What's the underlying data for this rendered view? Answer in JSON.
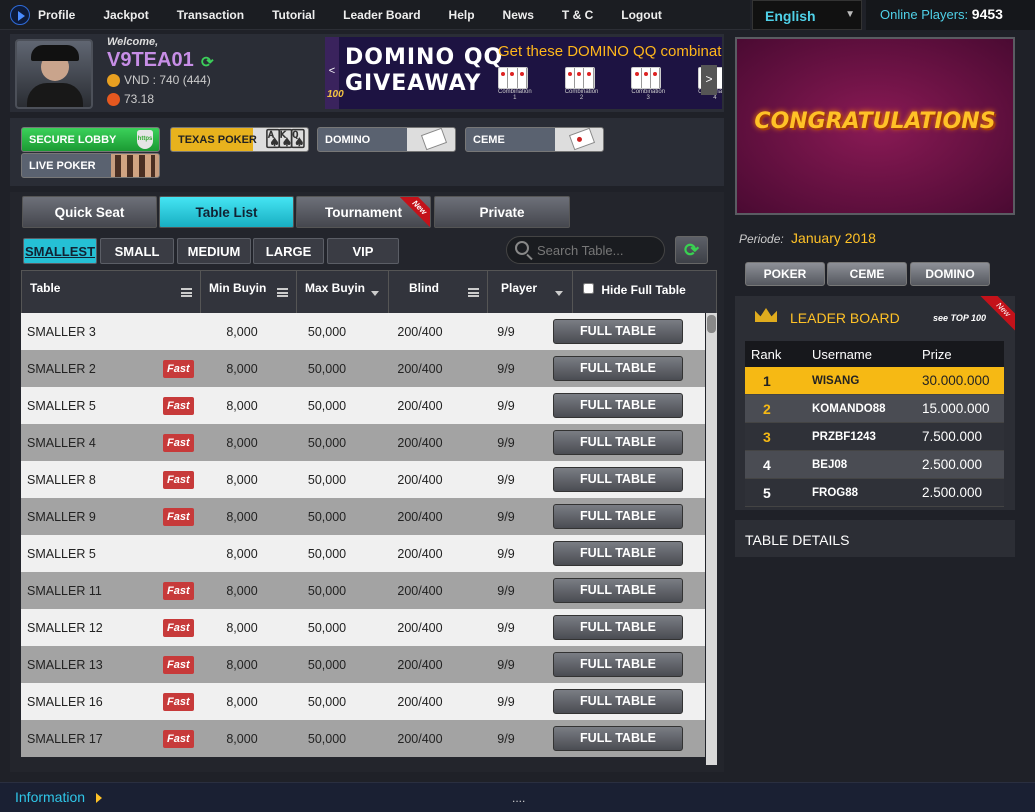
{
  "nav": {
    "items": [
      "Profile",
      "Jackpot",
      "Transaction",
      "Tutorial",
      "Leader Board",
      "Help",
      "News",
      "T & C",
      "Logout"
    ]
  },
  "language": {
    "selected": "English"
  },
  "online": {
    "label": "Online Players:",
    "count": "9453"
  },
  "user": {
    "welcome": "Welcome,",
    "name": "V9TEA01",
    "balance": "VND : 740 (444)",
    "score": "73.18"
  },
  "banner": {
    "title": "DOMINO QQ\nGIVEAWAY",
    "subtitle": "Get these DOMINO QQ combinati",
    "badge": "100",
    "combos": [
      "Combination 1",
      "Combination 2",
      "Combination 3",
      "Combination 4"
    ]
  },
  "games": {
    "secure": "SECURE LOBBY",
    "secure_badge": "https",
    "texas": "TEXAS POKER",
    "domino": "DOMINO",
    "ceme": "CEME",
    "live": "LIVE POKER"
  },
  "tabs": [
    "Quick Seat",
    "Table List",
    "Tournament",
    "Private"
  ],
  "new_label": "New",
  "filters": [
    "SMALLEST",
    "SMALL",
    "MEDIUM",
    "LARGE",
    "VIP"
  ],
  "search": {
    "placeholder": "Search Table..."
  },
  "table": {
    "headers": {
      "table": "Table",
      "min": "Min Buyin",
      "max": "Max Buyin",
      "blind": "Blind",
      "player": "Player",
      "hide": "Hide Full Table"
    },
    "fast_label": "Fast",
    "button_label": "FULL TABLE",
    "rows": [
      {
        "name": "SMALLER 3",
        "fast": false,
        "min": "8,000",
        "max": "50,000",
        "blind": "200/400",
        "player": "9/9"
      },
      {
        "name": "SMALLER 2",
        "fast": true,
        "min": "8,000",
        "max": "50,000",
        "blind": "200/400",
        "player": "9/9"
      },
      {
        "name": "SMALLER 5",
        "fast": true,
        "min": "8,000",
        "max": "50,000",
        "blind": "200/400",
        "player": "9/9"
      },
      {
        "name": "SMALLER 4",
        "fast": true,
        "min": "8,000",
        "max": "50,000",
        "blind": "200/400",
        "player": "9/9"
      },
      {
        "name": "SMALLER 8",
        "fast": true,
        "min": "8,000",
        "max": "50,000",
        "blind": "200/400",
        "player": "9/9"
      },
      {
        "name": "SMALLER 9",
        "fast": true,
        "min": "8,000",
        "max": "50,000",
        "blind": "200/400",
        "player": "9/9"
      },
      {
        "name": "SMALLER 5",
        "fast": false,
        "min": "8,000",
        "max": "50,000",
        "blind": "200/400",
        "player": "9/9"
      },
      {
        "name": "SMALLER 11",
        "fast": true,
        "min": "8,000",
        "max": "50,000",
        "blind": "200/400",
        "player": "9/9"
      },
      {
        "name": "SMALLER 12",
        "fast": true,
        "min": "8,000",
        "max": "50,000",
        "blind": "200/400",
        "player": "9/9"
      },
      {
        "name": "SMALLER 13",
        "fast": true,
        "min": "8,000",
        "max": "50,000",
        "blind": "200/400",
        "player": "9/9"
      },
      {
        "name": "SMALLER 16",
        "fast": true,
        "min": "8,000",
        "max": "50,000",
        "blind": "200/400",
        "player": "9/9"
      },
      {
        "name": "SMALLER 17",
        "fast": true,
        "min": "8,000",
        "max": "50,000",
        "blind": "200/400",
        "player": "9/9"
      }
    ]
  },
  "congrats": {
    "text": "CONGRATULATIONS"
  },
  "periode": {
    "label": "Periode:",
    "value": "January 2018"
  },
  "right_tabs": [
    "POKER",
    "CEME",
    "DOMINO"
  ],
  "leaderboard": {
    "title": "LEADER BOARD",
    "top": "see TOP 100",
    "headers": [
      "Rank",
      "Username",
      "Prize"
    ],
    "rows": [
      {
        "rank": "1",
        "user": "WISANG",
        "prize": "30.000.000"
      },
      {
        "rank": "2",
        "user": "KOMANDO88",
        "prize": "15.000.000"
      },
      {
        "rank": "3",
        "user": "PRZBF1243",
        "prize": "7.500.000"
      },
      {
        "rank": "4",
        "user": "BEJ08",
        "prize": "2.500.000"
      },
      {
        "rank": "5",
        "user": "FROG88",
        "prize": "2.500.000"
      }
    ]
  },
  "table_details": "TABLE DETAILS",
  "footer": {
    "info": "Information",
    "dots": "...."
  },
  "colors": {
    "accent": "#25c0d5",
    "gold": "#ffc227",
    "fast": "#c73a3a",
    "username": "#c78ee6"
  }
}
